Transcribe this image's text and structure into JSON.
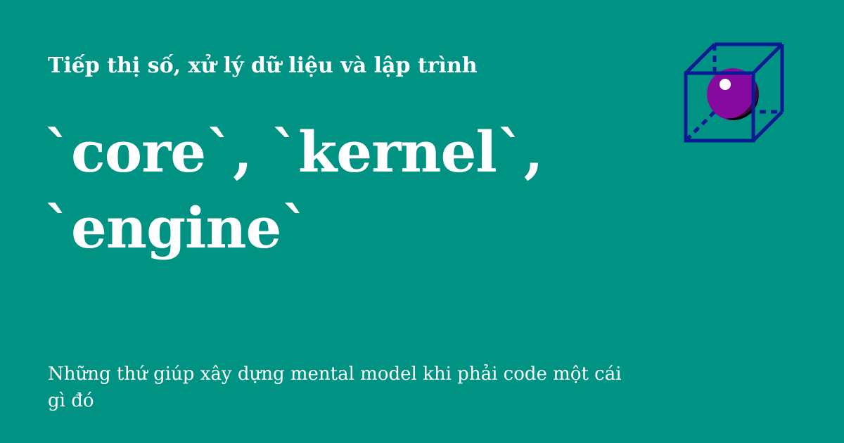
{
  "header": {
    "site_title": "Tiếp thị số, xử lý dữ liệu và lập trình"
  },
  "post": {
    "title": "`core`, `kernel`, `engine`",
    "description": "Những thứ giúp xây dựng mental model khi phải code một cái gì đó"
  },
  "logo": {
    "icon": "cube-with-sphere-icon",
    "colors": {
      "cube_stroke": "#0a1a93",
      "sphere_main": "#870a9f",
      "sphere_dark": "#3b0842",
      "sphere_highlight": "#ffffff"
    }
  },
  "theme": {
    "background": "#009384",
    "text": "#ffffff"
  }
}
